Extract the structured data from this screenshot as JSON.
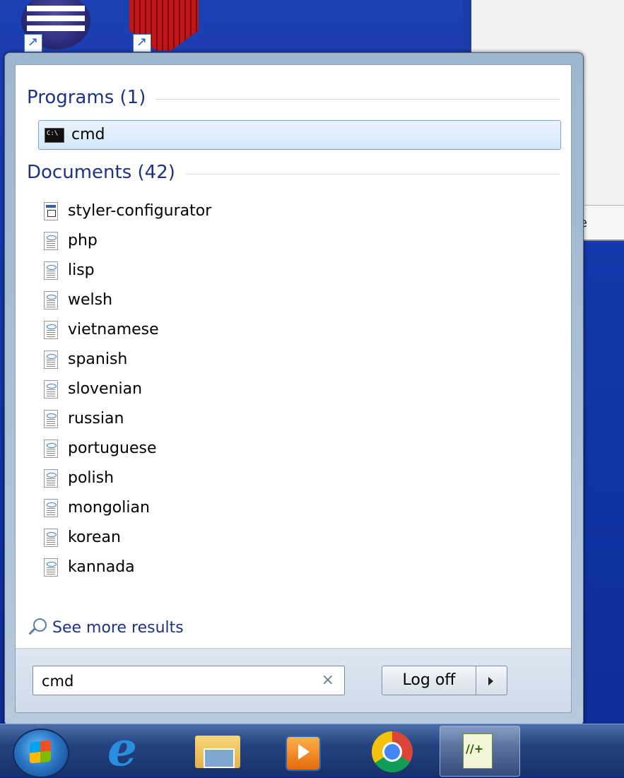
{
  "window_title": "Start menu search",
  "programs_group": {
    "header": "Programs (1)",
    "items": [
      {
        "label": "cmd",
        "icon": "command-prompt-icon",
        "selected": true
      }
    ]
  },
  "documents_group": {
    "header": "Documents (42)",
    "items": [
      {
        "label": "styler-configurator",
        "icon": "xml-file-icon"
      },
      {
        "label": "php",
        "icon": "xml-document-icon"
      },
      {
        "label": "lisp",
        "icon": "xml-document-icon"
      },
      {
        "label": "welsh",
        "icon": "xml-document-icon"
      },
      {
        "label": "vietnamese",
        "icon": "xml-document-icon"
      },
      {
        "label": "spanish",
        "icon": "xml-document-icon"
      },
      {
        "label": "slovenian",
        "icon": "xml-document-icon"
      },
      {
        "label": "russian",
        "icon": "xml-document-icon"
      },
      {
        "label": "portuguese",
        "icon": "xml-document-icon"
      },
      {
        "label": "polish",
        "icon": "xml-document-icon"
      },
      {
        "label": "mongolian",
        "icon": "xml-document-icon"
      },
      {
        "label": "korean",
        "icon": "xml-document-icon"
      },
      {
        "label": "kannada",
        "icon": "xml-document-icon"
      }
    ]
  },
  "see_more": {
    "label": "See more results",
    "icon": "magnifier-icon"
  },
  "search": {
    "value": "cmd",
    "placeholder": "",
    "clear_icon": "×"
  },
  "shutdown": {
    "label": "Log off",
    "arrow_icon": "triangle-right-icon"
  },
  "background_window": {
    "partial_text": "e"
  },
  "taskbar": {
    "items": [
      {
        "name": "start-orb",
        "icon": "windows-logo-icon"
      },
      {
        "name": "internet-explorer",
        "icon": "internet-explorer-icon",
        "glyph": "e"
      },
      {
        "name": "windows-explorer",
        "icon": "folder-icon"
      },
      {
        "name": "windows-media-player",
        "icon": "media-player-icon"
      },
      {
        "name": "google-chrome",
        "icon": "chrome-icon"
      },
      {
        "name": "notepad-plus-plus",
        "icon": "notepad-plus-plus-icon",
        "active": true
      }
    ]
  },
  "colors": {
    "group_header": "#1e3287",
    "selection_bg": "#d4e8fb",
    "selection_border": "#7da2ce",
    "desktop_bg": "#1238a8"
  }
}
